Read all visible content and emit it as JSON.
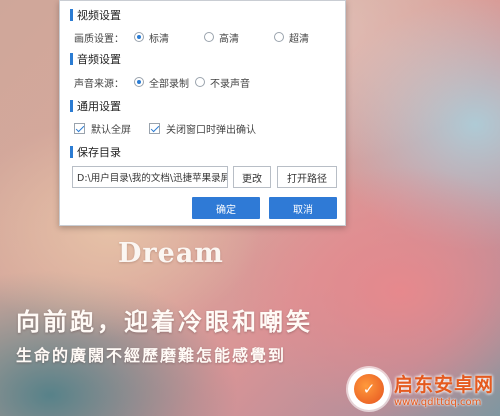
{
  "dialog": {
    "video": {
      "title": "视频设置",
      "label": "画质设置：",
      "options": [
        "标清",
        "高清",
        "超清"
      ],
      "selected": "标清"
    },
    "audio": {
      "title": "音频设置",
      "label": "声音来源：",
      "options": [
        "全部录制",
        "不录声音"
      ],
      "selected": "全部录制"
    },
    "general": {
      "title": "通用设置",
      "fullscreen_label": "默认全屏",
      "fullscreen_checked": true,
      "confirm_close_label": "关闭窗口时弹出确认",
      "confirm_close_checked": true
    },
    "save": {
      "title": "保存目录",
      "path_value": "D:\\用户目录\\我的文档\\迅捷苹果录屏",
      "change_label": "更改",
      "open_path_label": "打开路径"
    },
    "ok_label": "确定",
    "cancel_label": "取消"
  },
  "background": {
    "dream_text": "Dream",
    "poem_line1": "向前跑，迎着冷眼和嘲笑",
    "poem_line2": "生命的廣闊不經歷磨難怎能感覺到"
  },
  "watermark": {
    "logo_glyph": "✓",
    "name": "启东安卓网",
    "url": "www.qdlttdq.com"
  },
  "colors": {
    "accent": "#2f7ad6",
    "section_bar": "#2b7cd3",
    "watermark": "#e55a1f"
  }
}
